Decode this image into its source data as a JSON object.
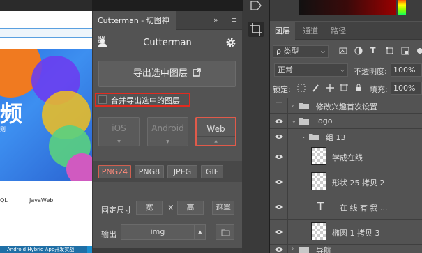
{
  "web_preview": {
    "banner_text": "频",
    "banner_sub": "则",
    "nav": [
      "QL",
      "JavaWeb"
    ],
    "bottom_text": "Android Hybrid App开发实战"
  },
  "cutterman": {
    "tab_label": "Cutterman - 切图神器",
    "collapse_glyph": "»",
    "menu_glyph": "≡",
    "title": "Cutterman",
    "export_label": "导出选中图层",
    "merge_label": "合并导出选中的图层",
    "platforms": [
      "iOS",
      "Android",
      "Web"
    ],
    "selected_platform": "Web",
    "formats": [
      "PNG24",
      "PNG8",
      "JPEG",
      "GIF"
    ],
    "selected_format": "PNG24",
    "size_label": "固定尺寸",
    "width_label": "宽",
    "x_label": "X",
    "height_label": "高",
    "clip_label": "遮罩",
    "output_label": "输出",
    "output_value": "img"
  },
  "layers_panel": {
    "tabs": [
      "图层",
      "通道",
      "路径"
    ],
    "filter_value": "ρ 类型",
    "blend_mode": "正常",
    "opacity_label": "不透明度:",
    "opacity_value": "100%",
    "lock_label": "锁定:",
    "fill_label": "填充:",
    "fill_value": "100%",
    "layers": [
      {
        "name": "修改兴趣首次设置",
        "type": "folder",
        "visible": false,
        "indent": 0
      },
      {
        "name": "logo",
        "type": "folder",
        "visible": true,
        "indent": 0,
        "expanded": true
      },
      {
        "name": "组 13",
        "type": "folder",
        "visible": true,
        "indent": 1,
        "expanded": true
      },
      {
        "name": "学成在线",
        "type": "smart",
        "visible": true,
        "indent": 2
      },
      {
        "name": "形状 25 拷贝 2",
        "type": "shape",
        "visible": true,
        "indent": 2
      },
      {
        "name": "在 线 有 我  ...",
        "type": "text",
        "visible": true,
        "indent": 2
      },
      {
        "name": "椭圆 1 拷贝 3",
        "type": "shape",
        "visible": true,
        "indent": 2
      },
      {
        "name": "导航",
        "type": "folder",
        "visible": true,
        "indent": 0
      }
    ]
  },
  "colors": {
    "accent_red": "#e02b20",
    "panel_bg": "#535353",
    "selected_format": "#ff8a7a"
  }
}
